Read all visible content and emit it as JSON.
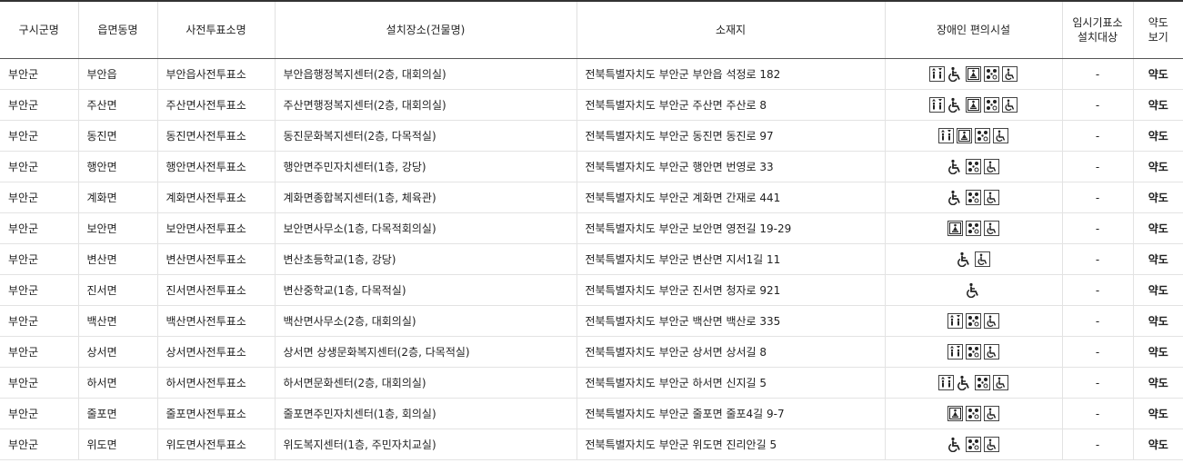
{
  "headers": {
    "col1": "구시군명",
    "col2": "읍면동명",
    "col3": "사전투표소명",
    "col4": "설치장소(건물명)",
    "col5": "소재지",
    "col6": "장애인 편의시설",
    "col7_l1": "임시기표소",
    "col7_l2": "설치대상",
    "col8_l1": "약도",
    "col8_l2": "보기"
  },
  "rows": [
    {
      "sigungu": "부안군",
      "eupmyeon": "부안읍",
      "station": "부안읍사전투표소",
      "place": "부안읍행정복지센터(2층, 대회의실)",
      "address": "전북특별자치도 부안군 부안읍 석정로 182",
      "facilities": [
        "elevator-icon",
        "wheelchair-icon",
        "stair-lift-icon",
        "braille-icon",
        "accessible-toilet-icon"
      ],
      "temp": "-",
      "map": "약도"
    },
    {
      "sigungu": "부안군",
      "eupmyeon": "주산면",
      "station": "주산면사전투표소",
      "place": "주산면행정복지센터(2층, 대회의실)",
      "address": "전북특별자치도 부안군 주산면 주산로 8",
      "facilities": [
        "elevator-icon",
        "wheelchair-icon",
        "stair-lift-icon",
        "braille-icon",
        "accessible-toilet-icon"
      ],
      "temp": "-",
      "map": "약도"
    },
    {
      "sigungu": "부안군",
      "eupmyeon": "동진면",
      "station": "동진면사전투표소",
      "place": "동진문화복지센터(2층, 다목적실)",
      "address": "전북특별자치도 부안군 동진면 동진로 97",
      "facilities": [
        "elevator-icon",
        "stair-lift-icon",
        "braille-icon",
        "accessible-toilet-icon"
      ],
      "temp": "-",
      "map": "약도"
    },
    {
      "sigungu": "부안군",
      "eupmyeon": "행안면",
      "station": "행안면사전투표소",
      "place": "행안면주민자치센터(1층, 강당)",
      "address": "전북특별자치도 부안군 행안면 번영로 33",
      "facilities": [
        "wheelchair-icon",
        "braille-icon",
        "accessible-toilet-icon"
      ],
      "temp": "-",
      "map": "약도"
    },
    {
      "sigungu": "부안군",
      "eupmyeon": "계화면",
      "station": "계화면사전투표소",
      "place": "계화면종합복지센터(1층, 체육관)",
      "address": "전북특별자치도 부안군 계화면 간재로 441",
      "facilities": [
        "wheelchair-icon",
        "braille-icon",
        "accessible-toilet-icon"
      ],
      "temp": "-",
      "map": "약도"
    },
    {
      "sigungu": "부안군",
      "eupmyeon": "보안면",
      "station": "보안면사전투표소",
      "place": "보안면사무소(1층, 다목적회의실)",
      "address": "전북특별자치도 부안군 보안면 영전길 19-29",
      "facilities": [
        "stair-lift-icon",
        "braille-icon",
        "accessible-toilet-icon"
      ],
      "temp": "-",
      "map": "약도"
    },
    {
      "sigungu": "부안군",
      "eupmyeon": "변산면",
      "station": "변산면사전투표소",
      "place": "변산초등학교(1층, 강당)",
      "address": "전북특별자치도 부안군 변산면 지서1길 11",
      "facilities": [
        "wheelchair-icon",
        "accessible-toilet-icon"
      ],
      "temp": "-",
      "map": "약도"
    },
    {
      "sigungu": "부안군",
      "eupmyeon": "진서면",
      "station": "진서면사전투표소",
      "place": "변산중학교(1층, 다목적실)",
      "address": "전북특별자치도 부안군 진서면 청자로 921",
      "facilities": [
        "wheelchair-icon"
      ],
      "temp": "-",
      "map": "약도"
    },
    {
      "sigungu": "부안군",
      "eupmyeon": "백산면",
      "station": "백산면사전투표소",
      "place": "백산면사무소(2층, 대회의실)",
      "address": "전북특별자치도 부안군 백산면 백산로 335",
      "facilities": [
        "elevator-icon",
        "braille-icon",
        "accessible-toilet-icon"
      ],
      "temp": "-",
      "map": "약도"
    },
    {
      "sigungu": "부안군",
      "eupmyeon": "상서면",
      "station": "상서면사전투표소",
      "place": "상서면 상생문화복지센터(2층, 다목적실)",
      "address": "전북특별자치도 부안군 상서면 상서길 8",
      "facilities": [
        "elevator-icon",
        "braille-icon",
        "accessible-toilet-icon"
      ],
      "temp": "-",
      "map": "약도"
    },
    {
      "sigungu": "부안군",
      "eupmyeon": "하서면",
      "station": "하서면사전투표소",
      "place": "하서면문화센터(2층, 대회의실)",
      "address": "전북특별자치도 부안군 하서면 신지길 5",
      "facilities": [
        "elevator-icon",
        "wheelchair-icon",
        "braille-icon",
        "accessible-toilet-icon"
      ],
      "temp": "-",
      "map": "약도"
    },
    {
      "sigungu": "부안군",
      "eupmyeon": "줄포면",
      "station": "줄포면사전투표소",
      "place": "줄포면주민자치센터(1층, 회의실)",
      "address": "전북특별자치도 부안군 줄포면 줄포4길 9-7",
      "facilities": [
        "stair-lift-icon",
        "braille-icon",
        "accessible-toilet-icon"
      ],
      "temp": "-",
      "map": "약도"
    },
    {
      "sigungu": "부안군",
      "eupmyeon": "위도면",
      "station": "위도면사전투표소",
      "place": "위도복지센터(1층, 주민자치교실)",
      "address": "전북특별자치도 부안군 위도면 진리안길 5",
      "facilities": [
        "wheelchair-icon",
        "braille-icon",
        "accessible-toilet-icon"
      ],
      "temp": "-",
      "map": "약도"
    }
  ]
}
